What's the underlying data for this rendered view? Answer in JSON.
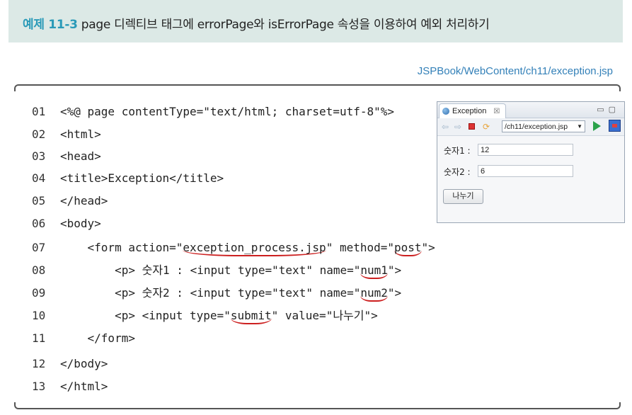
{
  "header": {
    "label": "예제 11-3",
    "title": "page 디렉티브 태그에 errorPage와 isErrorPage 속성을 이용하여 예외 처리하기"
  },
  "file_path": "JSPBook/WebContent/ch11/exception.jsp",
  "code": {
    "lines": [
      {
        "num": "01",
        "text": "<%@ page contentType=\"text/html; charset=utf-8\"%>"
      },
      {
        "num": "02",
        "text": "<html>"
      },
      {
        "num": "03",
        "text": "<head>"
      },
      {
        "num": "04",
        "text": "<title>Exception</title>"
      },
      {
        "num": "05",
        "text": "</head>"
      },
      {
        "num": "06",
        "text": "<body>"
      },
      {
        "num": "07",
        "pre": "    <form action=\"",
        "u1": "exception_process.jsp",
        "mid": "\" method=\"",
        "u2": "post",
        "post": "\">"
      },
      {
        "num": "08",
        "pre": "        <p> 숫자1 : <input type=\"text\" name=\"",
        "u1": "num1",
        "post": "\">"
      },
      {
        "num": "09",
        "pre": "        <p> 숫자2 : <input type=\"text\" name=\"",
        "u1": "num2",
        "post": "\">"
      },
      {
        "num": "10",
        "pre": "        <p> <input type=\"",
        "u1": "submit",
        "post": "\" value=\"나누기\">"
      },
      {
        "num": "11",
        "text": "    </form>"
      },
      {
        "num": "12",
        "text": "</body>"
      },
      {
        "num": "13",
        "text": "</html>"
      }
    ]
  },
  "browser": {
    "tab_title": "Exception",
    "tab_close": "☒",
    "url": "/ch11/exception.jsp",
    "field1_label": "숫자1 :",
    "field1_value": "12",
    "field2_label": "숫자2 :",
    "field2_value": "6",
    "submit_label": "나누기",
    "icons": [
      "globe-icon",
      "back-icon",
      "forward-icon",
      "stop-icon",
      "refresh-icon",
      "go-icon",
      "external-browser-icon"
    ]
  },
  "colors": {
    "header_bg": "#dce9e6",
    "label_color": "#2a9ab8",
    "path_color": "#3380b8",
    "underline_color": "#cc1f1f"
  }
}
